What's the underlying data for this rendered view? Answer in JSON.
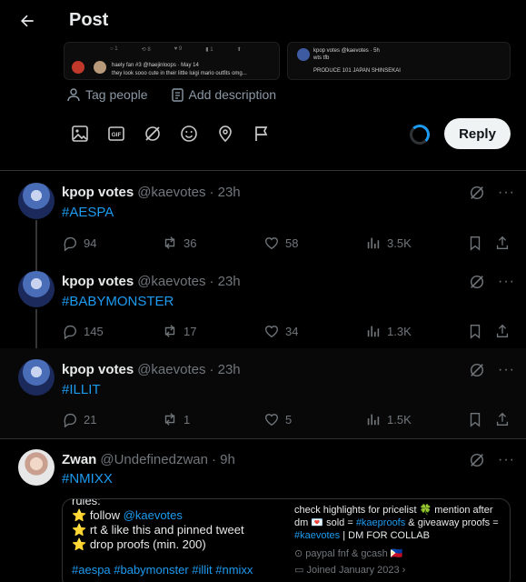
{
  "header": {
    "title": "Post"
  },
  "media_preview": {
    "card_a": {
      "name": "haely fan #3",
      "handle": "@haejinloops · May 14",
      "text": "they look sooo cute in their little luigi mario outfits omg..."
    },
    "card_b": {
      "name": "kpop votes",
      "handle": "@kaevotes · 5h",
      "line1": "wts tfb",
      "line2": "PRODUCE 101 JAPAN SHINSEKAI"
    }
  },
  "composer": {
    "tag_people": "Tag people",
    "add_description": "Add description",
    "reply_label": "Reply"
  },
  "tweets": [
    {
      "name": "kpop votes",
      "handle": "@kaevotes",
      "time": "· 23h",
      "text": "#AESPA",
      "replies": "94",
      "reposts": "36",
      "likes": "58",
      "views": "3.5K"
    },
    {
      "name": "kpop votes",
      "handle": "@kaevotes",
      "time": "· 23h",
      "text": "#BABYMONSTER",
      "replies": "145",
      "reposts": "17",
      "likes": "34",
      "views": "1.3K"
    },
    {
      "name": "kpop votes",
      "handle": "@kaevotes",
      "time": "· 23h",
      "text": "#ILLIT",
      "replies": "21",
      "reposts": "1",
      "likes": "5",
      "views": "1.5K"
    },
    {
      "name": "Zwan",
      "handle": "@Undefinedzwan",
      "time": "· 9h",
      "text": "#NMIXX"
    }
  ],
  "embed": {
    "rules_head": "rules:",
    "follow_prefix": "follow ",
    "follow_handle": "@kaevotes",
    "rt_line": "rt & like this and pinned tweet",
    "drop_line": "drop proofs (min. 200)",
    "tags": "#aespa #babymonster #illit #nmixx",
    "bio_1": "check highlights for pricelist 🍀 mention after",
    "bio_2a": "dm 💌 sold = ",
    "bio_2b": "#kaeproofs",
    "bio_2c": " & giveaway proofs =",
    "bio_3a": "#kaevotes",
    "bio_3b": " | DM FOR COLLAB",
    "location": "paypal fnf & gcash 🇵🇭",
    "joined": "Joined January 2023"
  },
  "colors": {
    "accent": "#1d9bf0",
    "muted": "#71767b",
    "text": "#e7e9ea",
    "reply_bg": "#eff3f4"
  }
}
